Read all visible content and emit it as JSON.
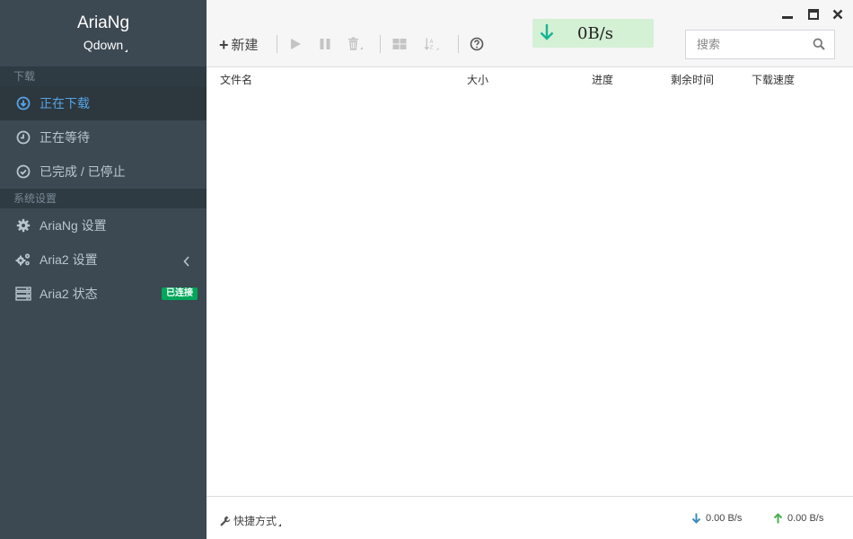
{
  "brand": {
    "title": "AriaNg",
    "subtitle": "Qdown"
  },
  "sidebar": {
    "section_download": "下载",
    "items_download": [
      {
        "label": "正在下载",
        "icon": "download-circle-icon",
        "active": true
      },
      {
        "label": "正在等待",
        "icon": "clock-icon",
        "active": false
      },
      {
        "label": "已完成 / 已停止",
        "icon": "check-circle-icon",
        "active": false
      }
    ],
    "section_settings": "系统设置",
    "items_settings": [
      {
        "label": "AriaNg 设置",
        "icon": "gear-icon"
      },
      {
        "label": "Aria2 设置",
        "icon": "gears-icon"
      },
      {
        "label": "Aria2 状态",
        "icon": "server-icon",
        "badge": "已连接"
      }
    ]
  },
  "toolbar": {
    "new_label": "新建",
    "download_speed": "0B/s",
    "search_placeholder": "搜索"
  },
  "table": {
    "columns": [
      "文件名",
      "大小",
      "进度",
      "剩余时间",
      "下载速度"
    ],
    "rows": []
  },
  "footer": {
    "shortcut_label": "快捷方式",
    "download_speed": "0.00 B/s",
    "upload_speed": "0.00 B/s"
  },
  "colors": {
    "sidebar_bg": "#3c4852",
    "active_link": "#57a4e4",
    "badge_green": "#00a65a",
    "speed_box_bg": "#d4f0d5",
    "speed_arrow": "#19b394"
  }
}
